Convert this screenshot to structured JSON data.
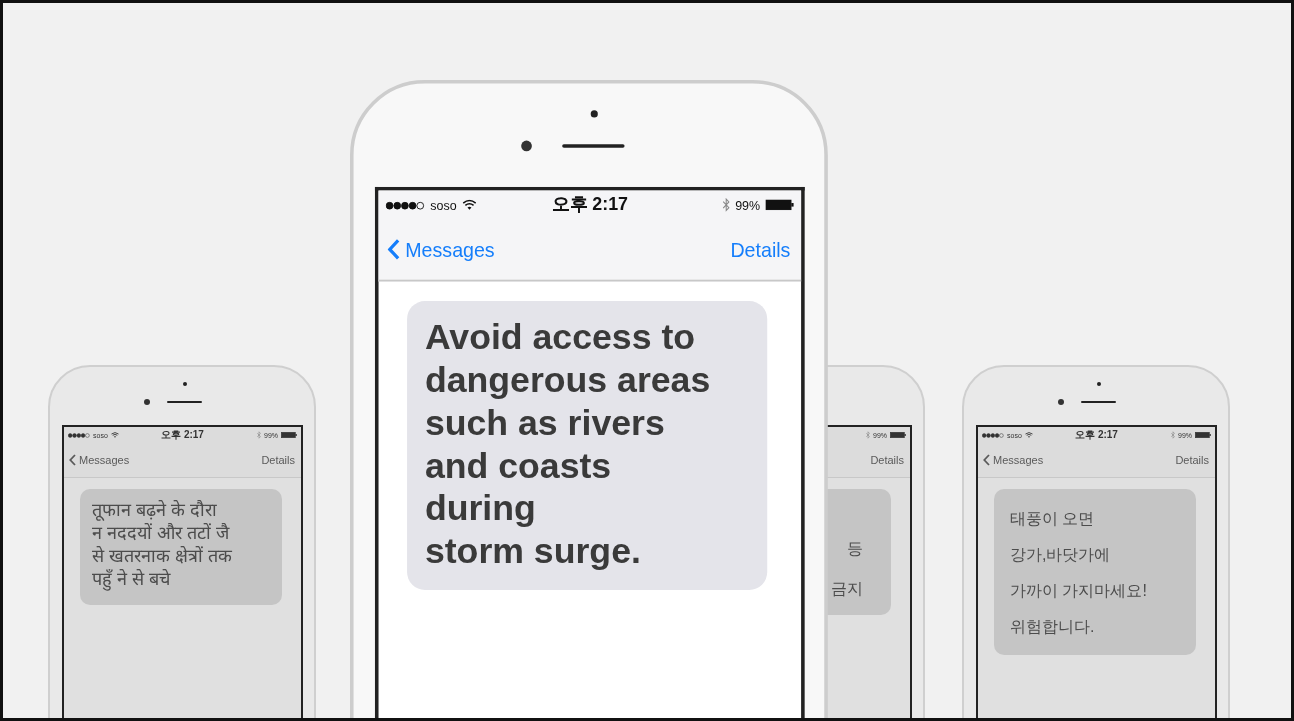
{
  "phones": [
    {
      "kind": "devanagari",
      "dimmed": true,
      "status": {
        "carrier": "soso",
        "time": "오후 2:17",
        "battery": "99%"
      },
      "nav": {
        "back": "Messages",
        "details": "Details"
      },
      "message": "तूफान बढ़ने के दौरा\nन नददयों और तटों जै\nसे खतरनाक क्षेत्रों तक\nपहुँ ने से बचे"
    },
    {
      "kind": "latin",
      "dimmed": false,
      "status": {
        "carrier": "soso",
        "time": "오후 2:17",
        "battery": "99%"
      },
      "nav": {
        "back": "Messages",
        "details": "Details"
      },
      "message": "Avoid access to\ndangerous areas\nsuch as rivers\nand coasts\nduring\nstorm surge."
    },
    {
      "kind": "fragment",
      "dimmed": true,
      "status": {
        "battery": "99%"
      },
      "nav": {
        "details": "Details"
      },
      "message": "등\n금지"
    },
    {
      "kind": "hangul",
      "dimmed": true,
      "status": {
        "carrier": "soso",
        "time": "오후 2:17",
        "battery": "99%"
      },
      "nav": {
        "back": "Messages",
        "details": "Details"
      },
      "message": "태풍이 오면\n강가,바닷가에\n가까이 가지마세요!\n위험합니다."
    }
  ]
}
